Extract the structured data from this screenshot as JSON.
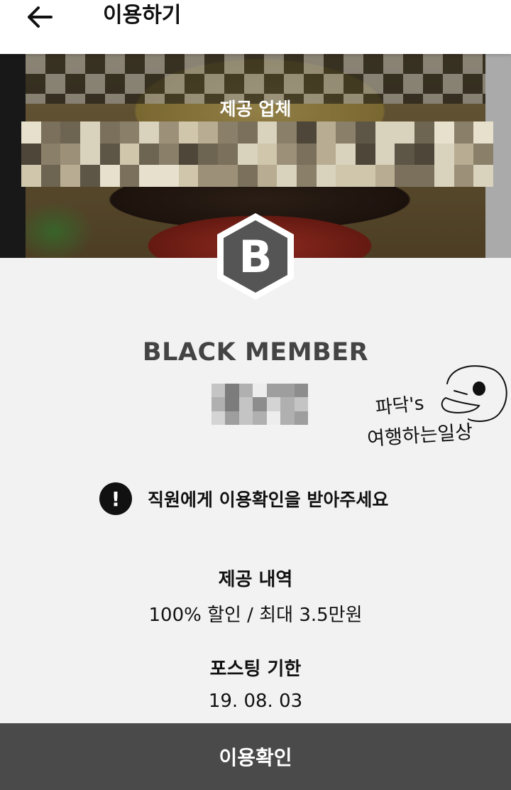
{
  "appbar": {
    "title": "이용하기",
    "back_icon": "arrow-left-icon"
  },
  "hero": {
    "vendor_label": "제공 업체"
  },
  "member": {
    "badge_letter": "B",
    "badge_color": "#555555",
    "level": "BLACK MEMBER"
  },
  "watermark": {
    "line1": "파닥's",
    "line2": "여행하는일상"
  },
  "notice": {
    "icon": "exclamation-circle-icon",
    "text": "직원에게 이용확인을 받아주세요"
  },
  "offer": {
    "title": "제공 내역",
    "value": "100% 할인 / 최대 3.5만원"
  },
  "posting": {
    "title": "포스팅 기한",
    "value": "19. 08. 03"
  },
  "confirm": {
    "label": "이용확인"
  },
  "colors": {
    "confirm_bar": "#4a4a4a",
    "body_bg": "#f2f2f2"
  }
}
